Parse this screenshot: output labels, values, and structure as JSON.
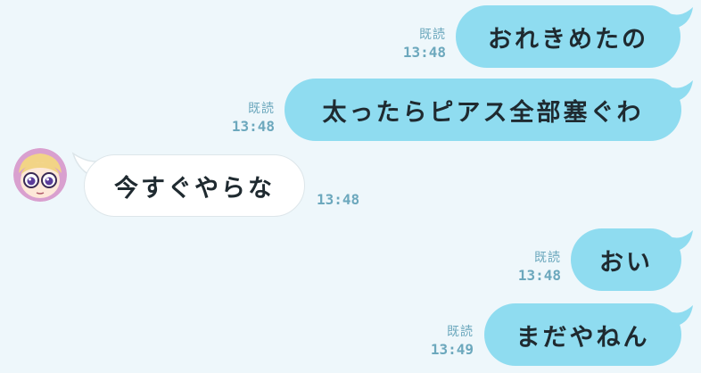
{
  "colors": {
    "background": "#eef7fb",
    "sent_bubble": "#8fdcf0",
    "received_bubble": "#ffffff",
    "meta_text": "#6ca8bd",
    "message_text": "#1f2a30"
  },
  "messages": [
    {
      "direction": "sent",
      "text": "おれきめたの",
      "read_label": "既読",
      "time": "13:48"
    },
    {
      "direction": "sent",
      "text": "太ったらピアス全部塞ぐわ",
      "read_label": "既読",
      "time": "13:48"
    },
    {
      "direction": "received",
      "text": "今すぐやらな",
      "time": "13:48",
      "avatar_icon": "cartoon-face-avatar-icon"
    },
    {
      "direction": "sent",
      "text": "おい",
      "read_label": "既読",
      "time": "13:48"
    },
    {
      "direction": "sent",
      "text": "まだやねん",
      "read_label": "既読",
      "time": "13:49"
    }
  ]
}
